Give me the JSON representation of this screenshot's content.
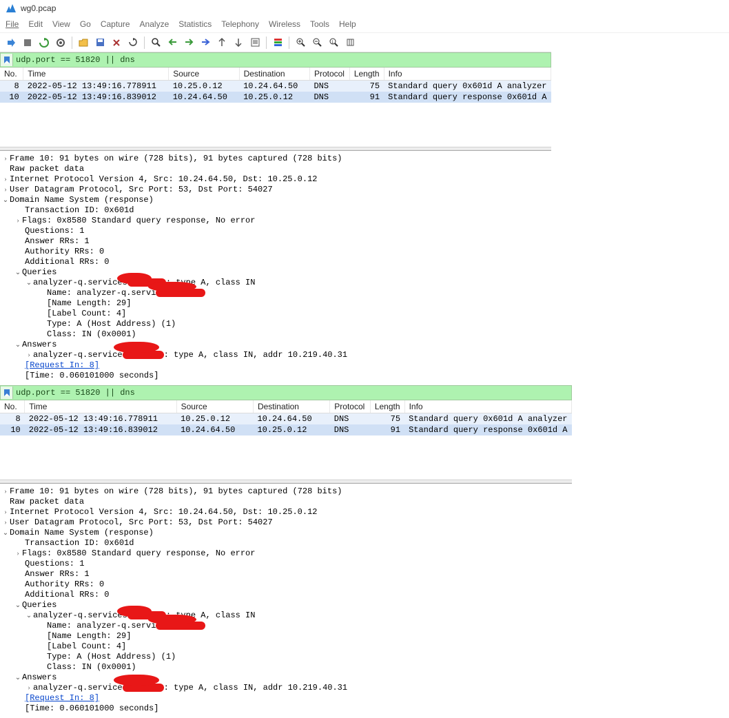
{
  "title": "wg0.pcap",
  "menu": [
    "File",
    "Edit",
    "View",
    "Go",
    "Capture",
    "Analyze",
    "Statistics",
    "Telephony",
    "Wireless",
    "Tools",
    "Help"
  ],
  "filter": "udp.port == 51820 || dns",
  "columns": {
    "no": "No.",
    "time": "Time",
    "source": "Source",
    "destination": "Destination",
    "protocol": "Protocol",
    "length": "Length",
    "info": "Info"
  },
  "packets": [
    {
      "no": "8",
      "time": "2022-05-12 13:49:16.778911",
      "src": "10.25.0.12",
      "dst": "10.24.64.50",
      "proto": "DNS",
      "len": "75",
      "info": "Standard query 0x601d A analyzer"
    },
    {
      "no": "10",
      "time": "2022-05-12 13:49:16.839012",
      "src": "10.24.64.50",
      "dst": "10.25.0.12",
      "proto": "DNS",
      "len": "91",
      "info": "Standard query response 0x601d A"
    }
  ],
  "details": {
    "frame": "Frame 10: 91 bytes on wire (728 bits), 91 bytes captured (728 bits)",
    "raw": "Raw packet data",
    "ip": "Internet Protocol Version 4, Src: 10.24.64.50, Dst: 10.25.0.12",
    "udp": "User Datagram Protocol, Src Port: 53, Dst Port: 54027",
    "dns": "Domain Name System (response)",
    "txid": "Transaction ID: 0x601d",
    "flags": "Flags: 0x8580 Standard query response, No error",
    "questions": "Questions: 1",
    "answer_rrs": "Answer RRs: 1",
    "auth_rrs": "Authority RRs: 0",
    "addl_rrs": "Additional RRs: 0",
    "queries": "Queries",
    "q_line_pre": "analyzer-q.services",
    "q_line_post": ": type A, class IN",
    "q_name_pre": "Name: analyzer-q.servi",
    "q_namelen": "[Name Length: 29]",
    "q_labelcnt": "[Label Count: 4]",
    "q_type": "Type: A (Host Address) (1)",
    "q_class": "Class: IN (0x0001)",
    "answers": "Answers",
    "a_line_pre": "analyzer-q.service",
    "a_line_post": ": type A, class IN, addr 10.219.40.31",
    "req_in": "[Request In: 8]",
    "time_delta": "[Time: 0.060101000 seconds]"
  }
}
